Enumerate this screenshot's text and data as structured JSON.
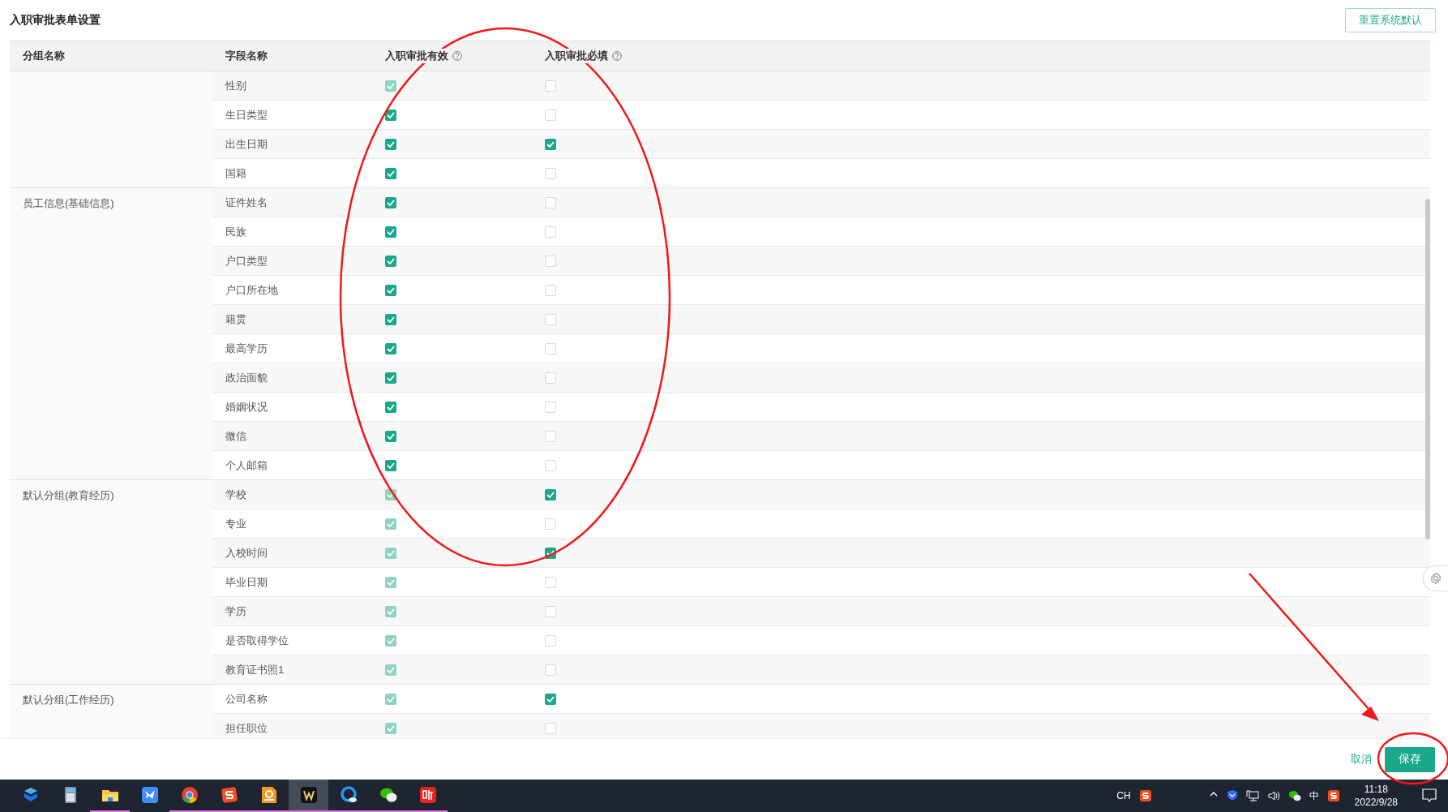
{
  "title": "入职审批表单设置",
  "reset_button": "重置系统默认",
  "columns": [
    {
      "label": "分组名称",
      "kind": "plain"
    },
    {
      "label": "字段名称",
      "kind": "plain"
    },
    {
      "label": "入职审批有效",
      "kind": "help"
    },
    {
      "label": "入职审批必填",
      "kind": "help"
    }
  ],
  "groups": [
    {
      "rows": [
        {
          "field": "性别",
          "valid_checked": true,
          "valid_disabled": true,
          "required_checked": false
        },
        {
          "field": "生日类型",
          "valid_checked": true,
          "valid_disabled": false,
          "required_checked": false
        },
        {
          "field": "出生日期",
          "valid_checked": true,
          "valid_disabled": false,
          "required_checked": true
        },
        {
          "field": "国籍",
          "valid_checked": true,
          "valid_disabled": false,
          "required_checked": false
        }
      ]
    },
    {
      "name": "员工信息(基础信息)",
      "rows": [
        {
          "field": "证件姓名",
          "valid_checked": true,
          "valid_disabled": false,
          "required_checked": false
        },
        {
          "field": "民族",
          "valid_checked": true,
          "valid_disabled": false,
          "required_checked": false
        },
        {
          "field": "户口类型",
          "valid_checked": true,
          "valid_disabled": false,
          "required_checked": false
        },
        {
          "field": "户口所在地",
          "valid_checked": true,
          "valid_disabled": false,
          "required_checked": false
        },
        {
          "field": "籍贯",
          "valid_checked": true,
          "valid_disabled": false,
          "required_checked": false
        },
        {
          "field": "最高学历",
          "valid_checked": true,
          "valid_disabled": false,
          "required_checked": false
        },
        {
          "field": "政治面貌",
          "valid_checked": true,
          "valid_disabled": false,
          "required_checked": false
        },
        {
          "field": "婚姻状况",
          "valid_checked": true,
          "valid_disabled": false,
          "required_checked": false
        },
        {
          "field": "微信",
          "valid_checked": true,
          "valid_disabled": false,
          "required_checked": false
        },
        {
          "field": "个人邮箱",
          "valid_checked": true,
          "valid_disabled": false,
          "required_checked": false
        }
      ]
    },
    {
      "name": "默认分组(教育经历)",
      "rows": [
        {
          "field": "学校",
          "valid_checked": true,
          "valid_disabled": true,
          "required_checked": true
        },
        {
          "field": "专业",
          "valid_checked": true,
          "valid_disabled": true,
          "required_checked": false
        },
        {
          "field": "入校时间",
          "valid_checked": true,
          "valid_disabled": true,
          "required_checked": true
        },
        {
          "field": "毕业日期",
          "valid_checked": true,
          "valid_disabled": true,
          "required_checked": false
        },
        {
          "field": "学历",
          "valid_checked": true,
          "valid_disabled": true,
          "required_checked": false
        },
        {
          "field": "是否取得学位",
          "valid_checked": true,
          "valid_disabled": true,
          "required_checked": false
        },
        {
          "field": "教育证书照1",
          "valid_checked": true,
          "valid_disabled": true,
          "required_checked": false
        }
      ]
    },
    {
      "name": "默认分组(工作经历)",
      "rows": [
        {
          "field": "公司名称",
          "valid_checked": true,
          "valid_disabled": true,
          "required_checked": true
        },
        {
          "field": "担任职位",
          "valid_checked": true,
          "valid_disabled": true,
          "required_checked": false
        }
      ]
    }
  ],
  "footer": {
    "cancel": "取消",
    "save": "保存"
  },
  "annotations": [
    {
      "kind": "ellipse"
    },
    {
      "kind": "arrow"
    },
    {
      "kind": "ellipse"
    }
  ],
  "taskbar": {
    "apps": [
      {
        "kind": "cube",
        "running": false,
        "selected": false
      },
      {
        "kind": "calculator",
        "running": false,
        "selected": false
      },
      {
        "kind": "folder",
        "running": true,
        "selected": false
      },
      {
        "kind": "bird",
        "running": false,
        "selected": false
      },
      {
        "kind": "browser",
        "running": true,
        "selected": false
      },
      {
        "kind": "sogou",
        "running": true,
        "selected": false
      },
      {
        "kind": "pdf",
        "running": true,
        "selected": false
      },
      {
        "kind": "wps",
        "running": true,
        "selected": true
      },
      {
        "kind": "qbrowser",
        "running": true,
        "selected": false
      },
      {
        "kind": "chat",
        "running": true,
        "selected": false
      },
      {
        "kind": "listen",
        "running": true,
        "selected": false
      }
    ],
    "tray": [
      {
        "kind": "text",
        "text": "CH"
      },
      {
        "kind": "sogou"
      },
      {
        "kind": "gap"
      },
      {
        "kind": "caret"
      },
      {
        "kind": "shield"
      },
      {
        "kind": "network"
      },
      {
        "kind": "volume"
      },
      {
        "kind": "chat"
      },
      {
        "kind": "text",
        "text": "中"
      },
      {
        "kind": "sogou"
      }
    ],
    "clock": {
      "time": "11:18",
      "date": "2022/9/28"
    }
  }
}
